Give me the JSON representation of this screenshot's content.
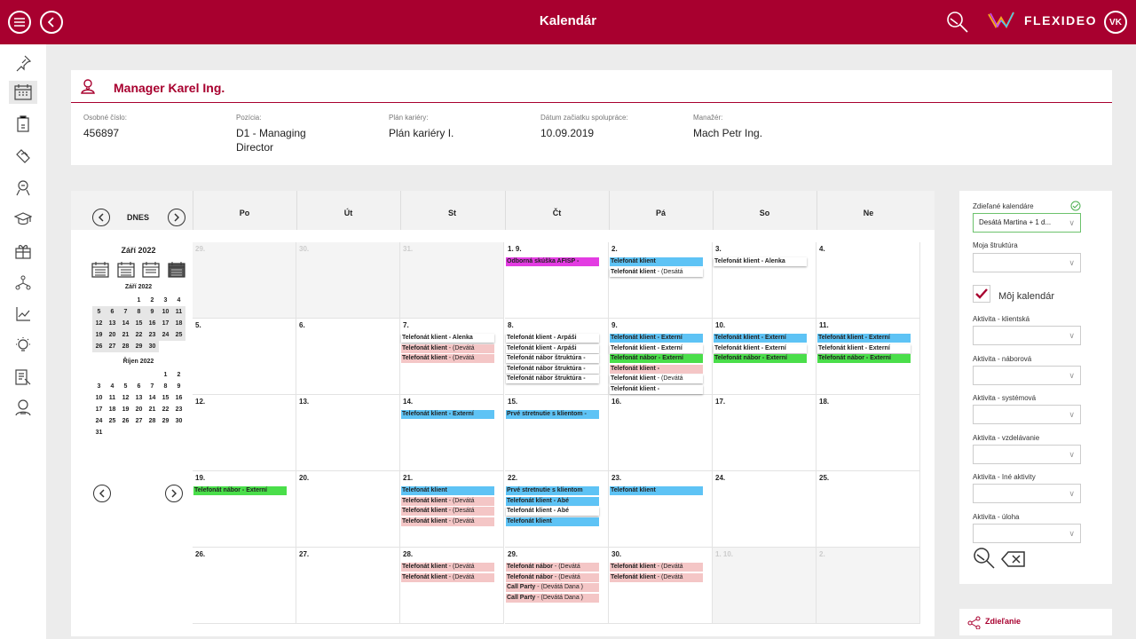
{
  "header": {
    "title": "Kalendár",
    "logo_text": "FLEXIDEO",
    "user_initials": "VK"
  },
  "sidebar": {
    "icons": [
      "pin-icon",
      "calendar-icon",
      "clipboard-icon",
      "handshake-icon",
      "users-icon",
      "graduation-icon",
      "gift-icon",
      "structure-icon",
      "chart-icon",
      "bulb-icon",
      "report-icon",
      "user-support-icon"
    ]
  },
  "profile": {
    "name": "Manager Karel Ing.",
    "fields": [
      {
        "label": "Osobné číslo:",
        "value": "456897"
      },
      {
        "label": "Pozícia:",
        "value": "D1 - Managing Director"
      },
      {
        "label": "Plán kariéry:",
        "value": "Plán kariéry I."
      },
      {
        "label": "Dátum začiatku spolupráce:",
        "value": "10.09.2019"
      },
      {
        "label": "Manažér:",
        "value": "Mach Petr Ing."
      }
    ]
  },
  "calendar": {
    "today_label": "DNES",
    "day_names": [
      "Po",
      "Út",
      "St",
      "Čt",
      "Pá",
      "So",
      "Ne"
    ],
    "mini": {
      "title": "Září 2022",
      "months": [
        {
          "name": "Září 2022",
          "lead": 3,
          "days": 30,
          "highlight": [
            5,
            6,
            7,
            8,
            9,
            10,
            11,
            12,
            13,
            14,
            15,
            16,
            17,
            18,
            19,
            20,
            21,
            22,
            23,
            24,
            25,
            26,
            27,
            28,
            29,
            30
          ]
        },
        {
          "name": "Říjen 2022",
          "lead": 5,
          "days": 31,
          "highlight": []
        }
      ]
    },
    "weeks": [
      [
        {
          "num": "29.",
          "other": true,
          "events": []
        },
        {
          "num": "30.",
          "other": true,
          "events": []
        },
        {
          "num": "31.",
          "other": true,
          "events": []
        },
        {
          "num": "1. 9.",
          "events": [
            {
              "b": "Odborná skúška AFISP -",
              "t": "",
              "c": "mag"
            }
          ]
        },
        {
          "num": "2.",
          "events": [
            {
              "b": "Telefonát klient",
              "t": "",
              "c": "blue"
            },
            {
              "b": "Telefonát klient",
              "t": " - (Desátá",
              "c": "white"
            }
          ]
        },
        {
          "num": "3.",
          "events": [
            {
              "b": "Telefonát klient - Alenka",
              "t": "",
              "c": "white"
            }
          ]
        },
        {
          "num": "4.",
          "events": []
        }
      ],
      [
        {
          "num": "5.",
          "events": []
        },
        {
          "num": "6.",
          "events": []
        },
        {
          "num": "7.",
          "events": [
            {
              "b": "Telefonát klient - Alenka",
              "t": "",
              "c": "white"
            },
            {
              "b": "Telefonát klient",
              "t": " - (Devátá",
              "c": "pink"
            },
            {
              "b": "Telefonát klient",
              "t": " - (Devátá",
              "c": "pink"
            }
          ]
        },
        {
          "num": "8.",
          "events": [
            {
              "b": "Telefonát klient - Arpáši",
              "t": "",
              "c": "white"
            },
            {
              "b": "Telefonát klient - Arpáši",
              "t": "",
              "c": "white"
            },
            {
              "b": "Telefonát nábor štruktúra -",
              "t": "",
              "c": "white"
            },
            {
              "b": "Telefonát nábor štruktúra -",
              "t": "",
              "c": "white"
            },
            {
              "b": "Telefonát nábor štruktúra -",
              "t": "",
              "c": "white"
            }
          ]
        },
        {
          "num": "9.",
          "events": [
            {
              "b": "Telefonát klient - Externí",
              "t": "",
              "c": "blue"
            },
            {
              "b": "Telefonát klient - Externí",
              "t": "",
              "c": "white"
            },
            {
              "b": "Telefonát nábor - Externí",
              "t": "",
              "c": "green"
            },
            {
              "b": "Telefonát klient -",
              "t": "",
              "c": "pink"
            },
            {
              "b": "Telefonát klient",
              "t": " - (Devátá",
              "c": "white"
            },
            {
              "b": "Telefonát klient -",
              "t": "",
              "c": "white"
            }
          ]
        },
        {
          "num": "10.",
          "events": [
            {
              "b": "Telefonát klient - Externí",
              "t": "",
              "c": "blue"
            },
            {
              "b": "Telefonát klient - Externí",
              "t": "",
              "c": "white"
            },
            {
              "b": "Telefonát nábor - Externí",
              "t": "",
              "c": "green"
            }
          ]
        },
        {
          "num": "11.",
          "events": [
            {
              "b": "Telefonát klient - Externí",
              "t": "",
              "c": "blue"
            },
            {
              "b": "Telefonát klient - Externí",
              "t": "",
              "c": "white"
            },
            {
              "b": "Telefonát nábor - Externí",
              "t": "",
              "c": "green"
            }
          ]
        }
      ],
      [
        {
          "num": "12.",
          "events": []
        },
        {
          "num": "13.",
          "events": []
        },
        {
          "num": "14.",
          "events": [
            {
              "b": "Telefonát klient - Externí",
              "t": "",
              "c": "blue"
            }
          ]
        },
        {
          "num": "15.",
          "events": [
            {
              "b": "Prvé stretnutie s klientom -",
              "t": "",
              "c": "blue"
            }
          ]
        },
        {
          "num": "16.",
          "events": []
        },
        {
          "num": "17.",
          "events": []
        },
        {
          "num": "18.",
          "events": []
        }
      ],
      [
        {
          "num": "19.",
          "events": [
            {
              "b": "Telefonát nábor - Externí",
              "t": "",
              "c": "green"
            }
          ]
        },
        {
          "num": "20.",
          "events": []
        },
        {
          "num": "21.",
          "events": [
            {
              "b": "Telefonát klient",
              "t": "",
              "c": "blue"
            },
            {
              "b": "Telefonát klient",
              "t": " - (Devátá",
              "c": "pink"
            },
            {
              "b": "Telefonát klient",
              "t": " - (Desátá",
              "c": "pink"
            },
            {
              "b": "Telefonát klient",
              "t": " - (Devátá",
              "c": "pink"
            }
          ]
        },
        {
          "num": "22.",
          "events": [
            {
              "b": "Prvé stretnutie s klientom",
              "t": "",
              "c": "blue"
            },
            {
              "b": "Telefonát klient - Abé",
              "t": "",
              "c": "blue"
            },
            {
              "b": "Telefonát klient - Abé",
              "t": "",
              "c": "white"
            },
            {
              "b": "Telefonát klient",
              "t": "",
              "c": "blue"
            }
          ]
        },
        {
          "num": "23.",
          "events": [
            {
              "b": "Telefonát klient",
              "t": "",
              "c": "blue"
            }
          ]
        },
        {
          "num": "24.",
          "events": []
        },
        {
          "num": "25.",
          "events": []
        }
      ],
      [
        {
          "num": "26.",
          "events": []
        },
        {
          "num": "27.",
          "events": []
        },
        {
          "num": "28.",
          "events": [
            {
              "b": "Telefonát klient",
              "t": " - (Devátá",
              "c": "pink"
            },
            {
              "b": "Telefonát klient",
              "t": " - (Devátá",
              "c": "pink"
            }
          ]
        },
        {
          "num": "29.",
          "events": [
            {
              "b": "Telefonát nábor",
              "t": " - (Devátá",
              "c": "pink"
            },
            {
              "b": "Telefonát nábor",
              "t": " - (Devátá",
              "c": "pink"
            },
            {
              "b": "Call Party",
              "t": " - (Devátá Dana )",
              "c": "pink"
            },
            {
              "b": "Call Party",
              "t": " - (Devátá Dana )",
              "c": "pink"
            }
          ]
        },
        {
          "num": "30.",
          "events": [
            {
              "b": "Telefonát klient",
              "t": " - (Devátá",
              "c": "pink"
            },
            {
              "b": "Telefonát klient",
              "t": " - (Devátá",
              "c": "pink"
            }
          ]
        },
        {
          "num": "1. 10.",
          "other": true,
          "events": []
        },
        {
          "num": "2.",
          "other": true,
          "events": []
        }
      ]
    ]
  },
  "filters": {
    "shared_label": "Zdieľané kalendáre",
    "shared_value": "Desátá Martina + 1 d...",
    "structure_label": "Moja štruktúra",
    "my_calendar_label": "Môj kalendár",
    "selects": [
      "Aktivita - klientská",
      "Aktivita - náborová",
      "Aktivita - systémová",
      "Aktivita - vzdelávanie",
      "Aktivita - Iné aktivity",
      "Aktivita - úloha"
    ]
  },
  "share": {
    "label": "Zdieľanie"
  },
  "colors": {
    "brand": "#a8002f",
    "blue": "#5ec3f5",
    "pink": "#f4c6c6",
    "green": "#4ade4a",
    "magenta": "#e33ce2"
  }
}
